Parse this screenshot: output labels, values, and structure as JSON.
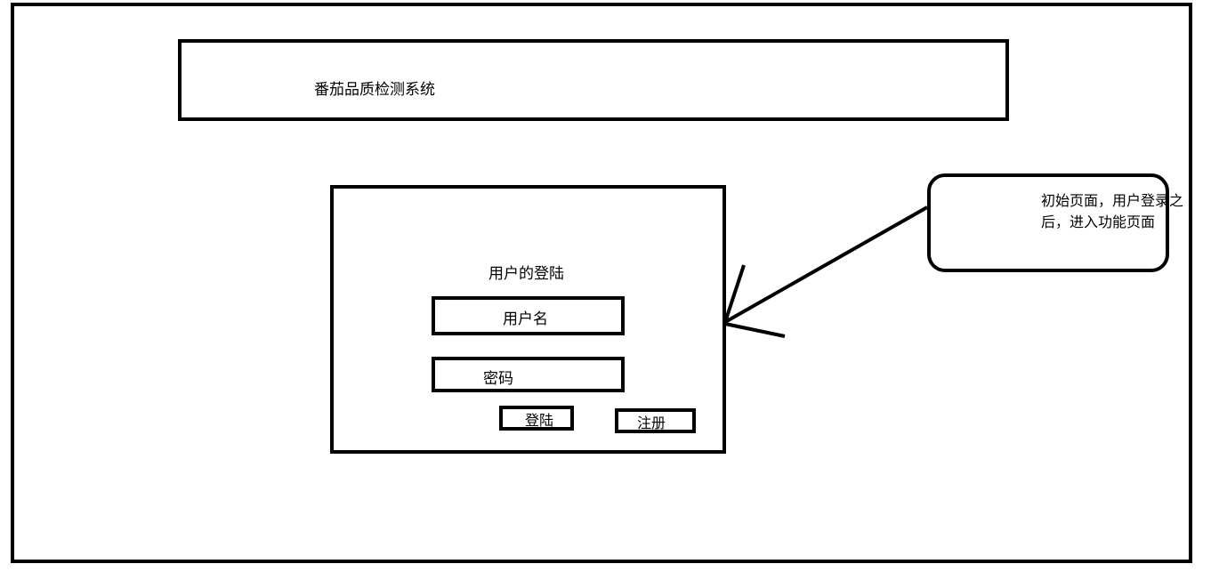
{
  "header": {
    "title": "番茄品质检测系统"
  },
  "login": {
    "heading": "用户的登陆",
    "username_label": "用户名",
    "password_label": "密码",
    "login_button": "登陆",
    "register_button": "注册"
  },
  "annotation": {
    "line1": "初始页面，用户登录之",
    "line2": "后，进入功能页面"
  }
}
